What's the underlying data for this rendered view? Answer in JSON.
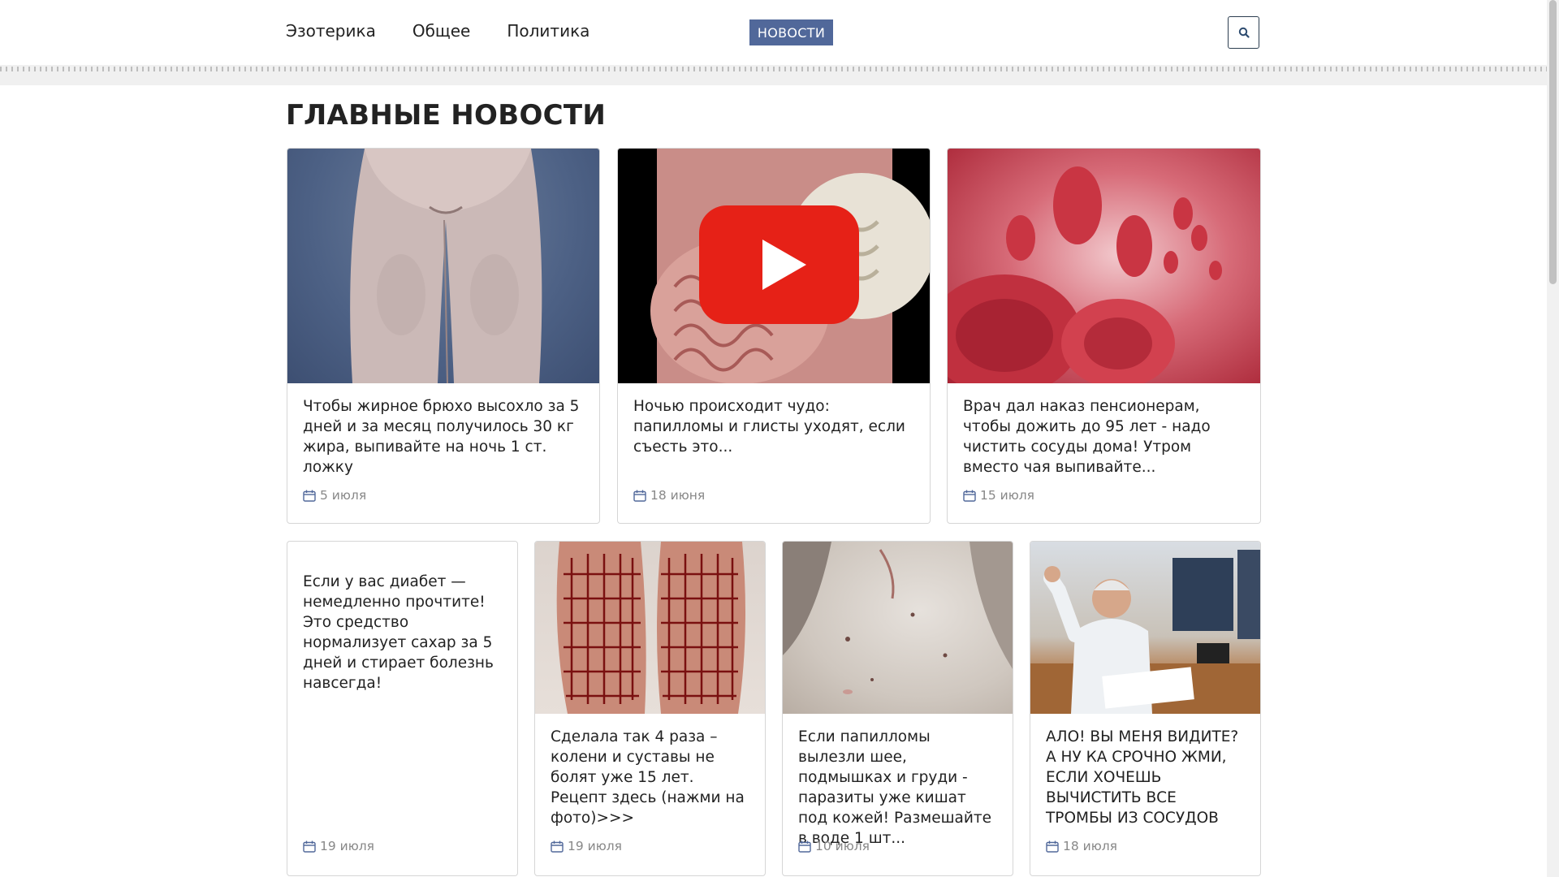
{
  "nav": {
    "items": [
      {
        "label": "Эзотерика"
      },
      {
        "label": "Общее"
      },
      {
        "label": "Политика"
      }
    ],
    "badge": "НОВОСТИ",
    "search_icon": "search-icon"
  },
  "section": {
    "title": "ГЛАВНЫЕ НОВОСТИ"
  },
  "cards": [
    {
      "title": "Чтобы жирное брюхо высохло за 5 дней и за месяц получилось 30 кг жира, выпивайте на ночь 1 ст. ложку",
      "date": "5 июля",
      "image": "legs-photo"
    },
    {
      "title": "Ночью происходит чудо: папилломы и глисты уходят, если съесть это...",
      "date": "18 июня",
      "image": "video-thumbnail"
    },
    {
      "title": "Врач дал наказ пенсионерам, чтобы дожить до 95 лет - надо чистить сосуды дома! Утром вместо чая выпивайте...",
      "date": "15 июля",
      "image": "blood-cells-photo"
    },
    {
      "title": "Если у вас диабет — немедленно прочтите! Это средство нормализует сахар за 5 дней и стирает болезнь навсегда!",
      "date": "19 июля",
      "image": ""
    },
    {
      "title": "Сделала так 4 раза – колени и суставы не болят уже 15 лет. Рецепт здесь (нажми на фото)>>>",
      "date": "19 июля",
      "image": "knees-grid-photo"
    },
    {
      "title": "Если папилломы вылезли шее, подмышках и груди - паразиты уже кишат под кожей! Размешайте в воде 1 шт...",
      "date": "10 июля",
      "image": "skin-photo"
    },
    {
      "title": "АЛО! ВЫ МЕНЯ ВИДИТЕ? А НУ КА СРОЧНО ЖМИ, ЕСЛИ ХОЧЕШЬ ВЫЧИСТИТЬ ВСЕ ТРОМБЫ ИЗ СОСУДОВ",
      "date": "18 июля",
      "image": "doctor-photo"
    }
  ],
  "colors": {
    "badge_bg": "#51689a",
    "text": "#222222",
    "date": "#888888",
    "youtube_red": "#e62117"
  }
}
